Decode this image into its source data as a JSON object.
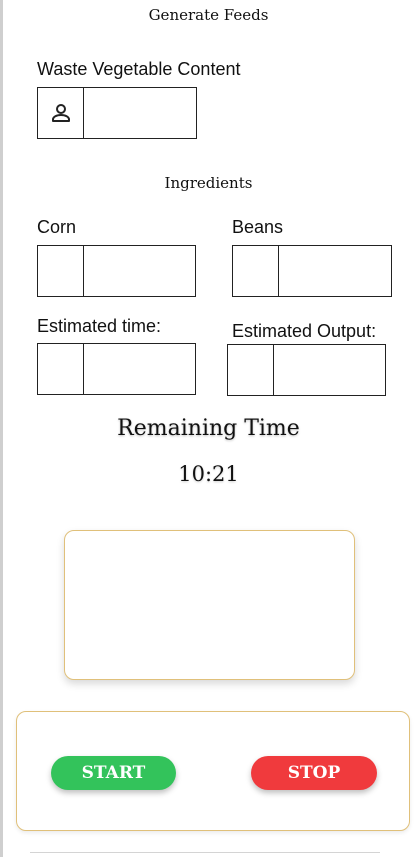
{
  "page": {
    "title": "Generate Feeds"
  },
  "waste": {
    "label": "Waste Vegetable Content",
    "value": "",
    "icon": "person-icon"
  },
  "ingredients": {
    "title": "Ingredients",
    "corn": {
      "label": "Corn",
      "value": ""
    },
    "beans": {
      "label": "Beans",
      "value": ""
    }
  },
  "estimates": {
    "time": {
      "label": "Estimated time:",
      "value": ""
    },
    "output": {
      "label": "Estimated Output:",
      "value": ""
    }
  },
  "remaining": {
    "label": "Remaining Time",
    "value": "10:21"
  },
  "controls": {
    "start_label": "START",
    "stop_label": "STOP"
  },
  "colors": {
    "start": "#33c35b",
    "stop": "#f03a3d",
    "panel_border": "#e0c07a"
  }
}
